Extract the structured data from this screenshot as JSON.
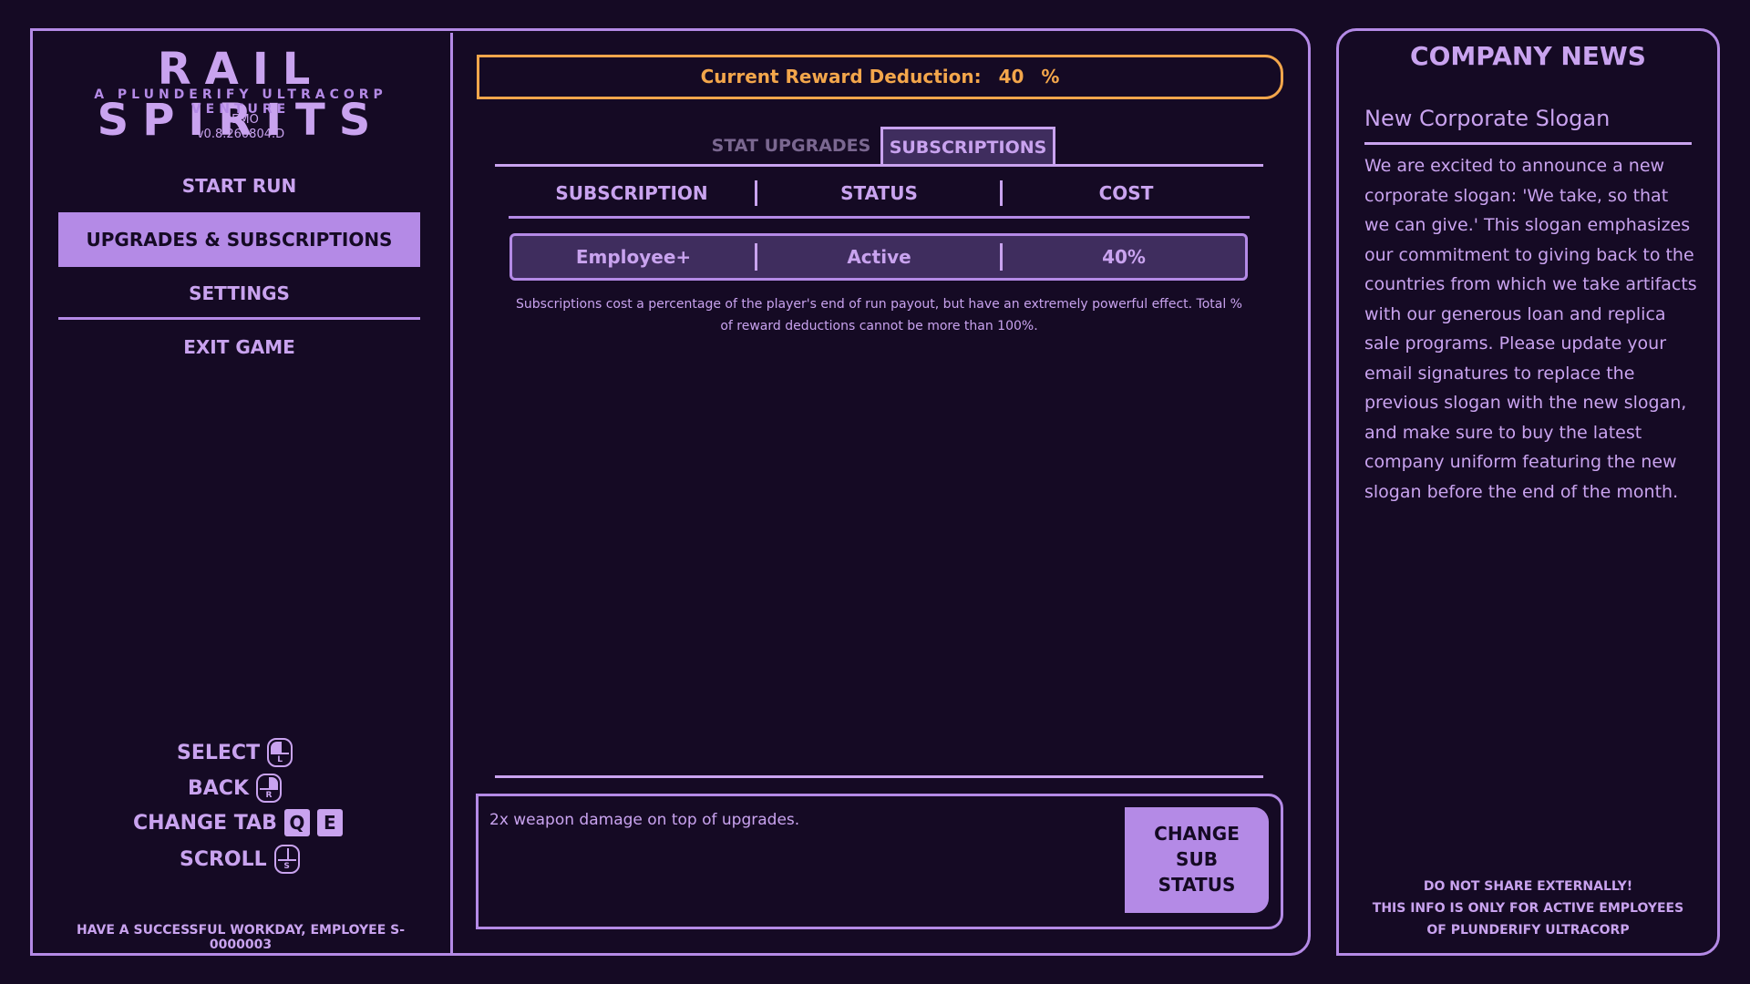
{
  "app": {
    "title": "RAIL SPIRITS",
    "subtitle": "A PLUNDERIFY ULTRACORP VENTURE",
    "build": "DEMO",
    "version": "v0.8.260804.D"
  },
  "menu": {
    "items": [
      {
        "label": "START RUN"
      },
      {
        "label": "UPGRADES & SUBSCRIPTIONS",
        "active": true
      },
      {
        "label": "SETTINGS"
      },
      {
        "label": "EXIT GAME"
      }
    ]
  },
  "controls": {
    "select": "SELECT",
    "back": "BACK",
    "change_tab": "CHANGE TAB",
    "scroll": "SCROLL",
    "key_q": "Q",
    "key_e": "E",
    "mouse_l": "L",
    "mouse_r": "R",
    "mouse_s": "S"
  },
  "footer_left": "HAVE A SUCCESSFUL WORKDAY, EMPLOYEE S-0000003",
  "deduction": {
    "label": "Current Reward Deduction:",
    "value": "40",
    "unit": "%"
  },
  "tabs": [
    {
      "label": "STAT UPGRADES",
      "active": false
    },
    {
      "label": "SUBSCRIPTIONS",
      "active": true
    }
  ],
  "table": {
    "headers": [
      "SUBSCRIPTION",
      "STATUS",
      "COST"
    ],
    "rows": [
      {
        "subscription": "Employee+",
        "status": "Active",
        "cost": "40%"
      }
    ],
    "note": "Subscriptions cost a percentage of the player's end of run payout, but have an extremely powerful effect. Total % of reward deductions cannot be more than 100%."
  },
  "description": "2x weapon damage on top of upgrades.",
  "change_button": {
    "line1": "CHANGE",
    "line2": "SUB",
    "line3": "STATUS"
  },
  "news": {
    "title": "COMPANY NEWS",
    "headline": "New Corporate Slogan",
    "body": "We are excited to announce a new corporate slogan: 'We take, so that we can give.' This slogan emphasizes our commitment to giving back to the countries from which we take artifacts with our generous loan and replica sale programs. Please update your email signatures to replace the previous slogan with the new slogan, and make sure to buy the latest company uniform featuring the new slogan before the end of the month.",
    "footer": [
      "DO NOT SHARE EXTERNALLY!",
      "THIS INFO IS ONLY FOR ACTIVE EMPLOYEES",
      "OF PLUNDERIFY ULTRACORP"
    ]
  },
  "colors": {
    "background": "#150a24",
    "accent": "#b48ae6",
    "text": "#c9a3ef",
    "warning": "#f3a64b",
    "row_fill": "#3f2d5e"
  }
}
